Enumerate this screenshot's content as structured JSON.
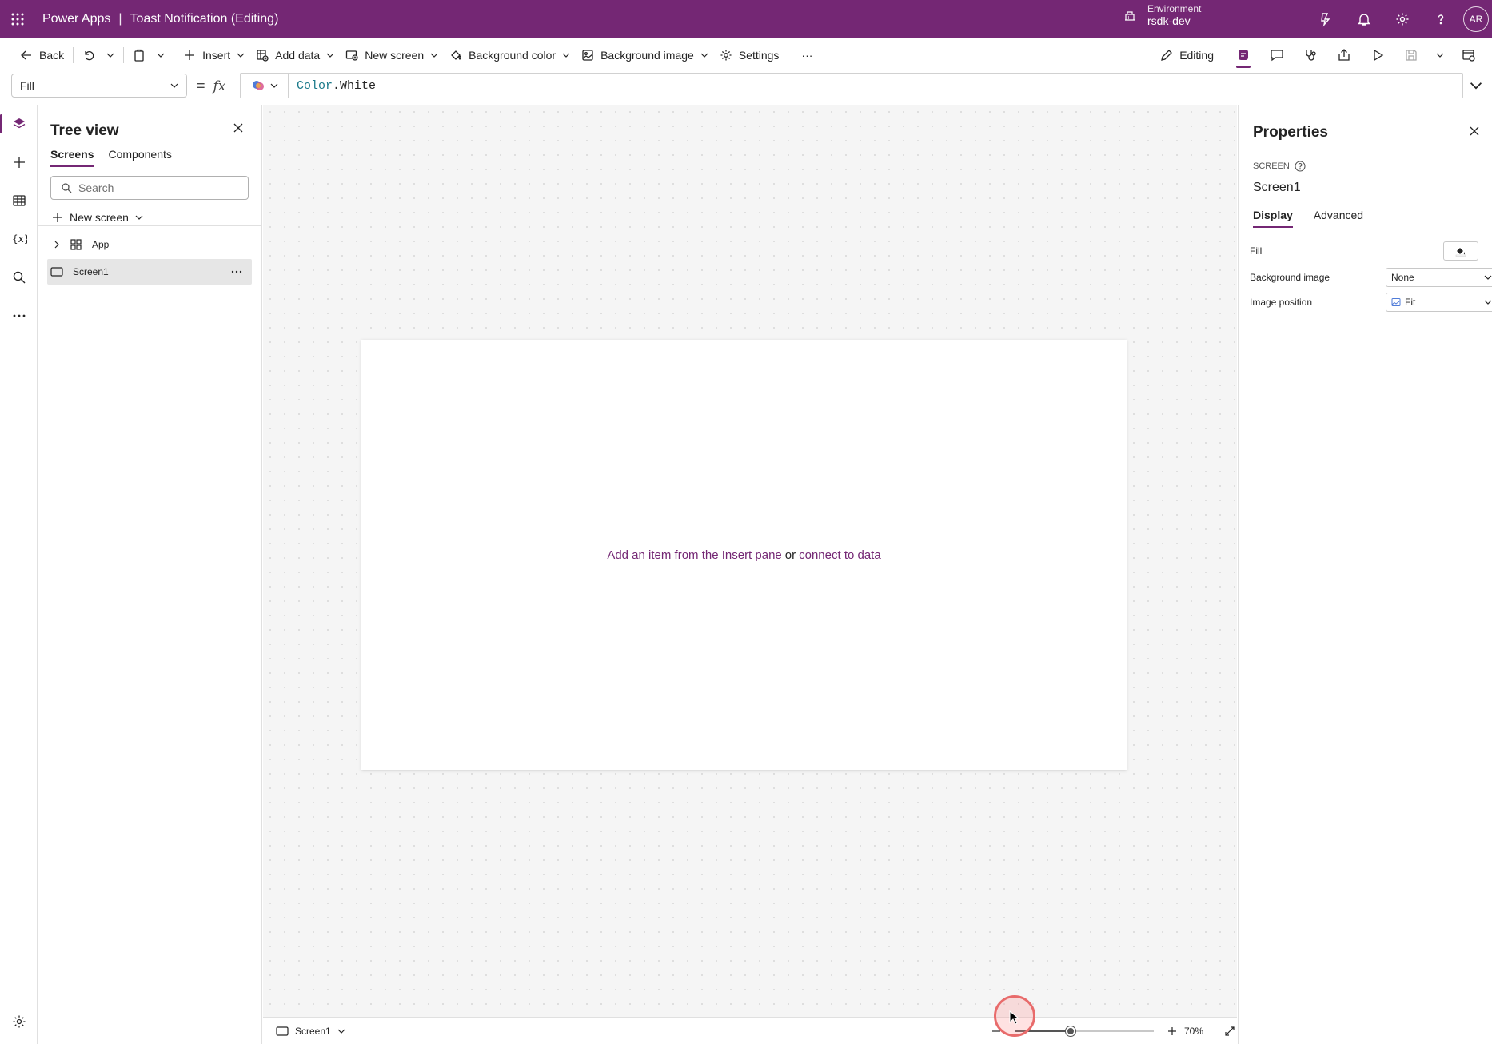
{
  "header": {
    "product": "Power Apps",
    "separator": "|",
    "app_title": "Toast Notification (Editing)",
    "environment_label": "Environment",
    "environment_name": "rsdk-dev",
    "avatar_initials": "AR"
  },
  "toolbar": {
    "back": "Back",
    "insert": "Insert",
    "add_data": "Add data",
    "new_screen": "New screen",
    "background_color": "Background color",
    "background_image": "Background image",
    "settings": "Settings",
    "more": "···",
    "editing": "Editing"
  },
  "formula": {
    "property": "Fill",
    "equals": "=",
    "fx": "fx",
    "object": "Color",
    "dot": ".",
    "member": "White"
  },
  "tree": {
    "title": "Tree view",
    "tabs": [
      "Screens",
      "Components"
    ],
    "search_placeholder": "Search",
    "new_screen": "New screen",
    "items": [
      {
        "label": "App",
        "icon": "app-icon"
      },
      {
        "label": "Screen1",
        "icon": "screen-icon",
        "selected": true
      }
    ]
  },
  "canvas": {
    "empty_part1": "Add an item from the Insert pane",
    "empty_or": "or",
    "empty_link": "connect to data"
  },
  "status": {
    "screen": "Screen1",
    "zoom": "70%",
    "zoom_level": 0.4
  },
  "properties": {
    "title": "Properties",
    "kind": "SCREEN",
    "name": "Screen1",
    "tabs": [
      "Display",
      "Advanced"
    ],
    "rows": [
      {
        "label": "Fill"
      },
      {
        "label": "Background image",
        "value": "None"
      },
      {
        "label": "Image position",
        "value": "Fit"
      }
    ]
  },
  "colors": {
    "brand": "#742774",
    "formula_keyword": "#1b7a8a"
  }
}
